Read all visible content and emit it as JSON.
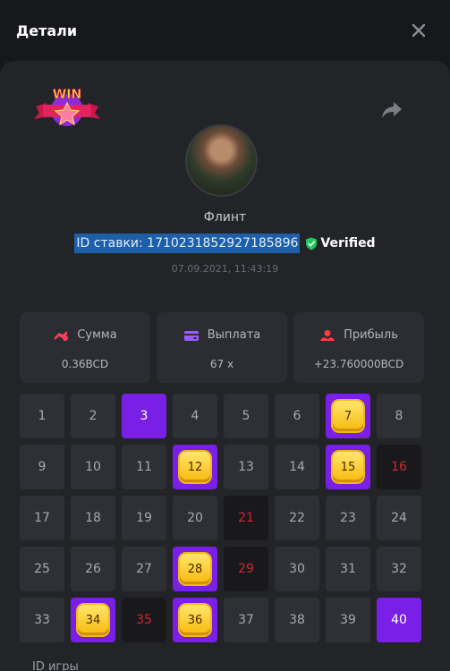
{
  "dialog": {
    "title": "Детали",
    "close_icon": "close-icon"
  },
  "header": {
    "badge": "WIN",
    "share_icon": "share-icon"
  },
  "player": {
    "name": "Флинт",
    "avatar_icon": "avatar"
  },
  "bet": {
    "id_text": "ID ставки: 1710231852927185896",
    "verified_label": "Verified",
    "date": "07.09.2021, 11:43:19"
  },
  "stats": [
    {
      "label": "Сумма",
      "value": "0.36BCD",
      "icon": "coins-icon",
      "color": "#ff3d5a"
    },
    {
      "label": "Выплата",
      "value": "67 x",
      "icon": "wallet-icon",
      "color": "#9b5cff"
    },
    {
      "label": "Прибыль",
      "value": "+23.760000BCD",
      "icon": "profit-icon",
      "color": "#ff3d3d"
    }
  ],
  "grid": {
    "cells": [
      {
        "n": "1",
        "s": "normal"
      },
      {
        "n": "2",
        "s": "normal"
      },
      {
        "n": "3",
        "s": "picked"
      },
      {
        "n": "4",
        "s": "normal"
      },
      {
        "n": "5",
        "s": "normal"
      },
      {
        "n": "6",
        "s": "normal"
      },
      {
        "n": "7",
        "s": "hit"
      },
      {
        "n": "8",
        "s": "normal"
      },
      {
        "n": "9",
        "s": "normal"
      },
      {
        "n": "10",
        "s": "normal"
      },
      {
        "n": "11",
        "s": "normal"
      },
      {
        "n": "12",
        "s": "hit"
      },
      {
        "n": "13",
        "s": "normal"
      },
      {
        "n": "14",
        "s": "normal"
      },
      {
        "n": "15",
        "s": "hit"
      },
      {
        "n": "16",
        "s": "miss"
      },
      {
        "n": "17",
        "s": "normal"
      },
      {
        "n": "18",
        "s": "normal"
      },
      {
        "n": "19",
        "s": "normal"
      },
      {
        "n": "20",
        "s": "normal"
      },
      {
        "n": "21",
        "s": "miss"
      },
      {
        "n": "22",
        "s": "normal"
      },
      {
        "n": "23",
        "s": "normal"
      },
      {
        "n": "24",
        "s": "normal"
      },
      {
        "n": "25",
        "s": "normal"
      },
      {
        "n": "26",
        "s": "normal"
      },
      {
        "n": "27",
        "s": "normal"
      },
      {
        "n": "28",
        "s": "hit"
      },
      {
        "n": "29",
        "s": "miss"
      },
      {
        "n": "30",
        "s": "normal"
      },
      {
        "n": "31",
        "s": "normal"
      },
      {
        "n": "32",
        "s": "normal"
      },
      {
        "n": "33",
        "s": "normal"
      },
      {
        "n": "34",
        "s": "hit"
      },
      {
        "n": "35",
        "s": "miss"
      },
      {
        "n": "36",
        "s": "hit"
      },
      {
        "n": "37",
        "s": "normal"
      },
      {
        "n": "38",
        "s": "normal"
      },
      {
        "n": "39",
        "s": "normal"
      },
      {
        "n": "40",
        "s": "picked"
      }
    ]
  },
  "footer": {
    "game_id_label": "ID игры"
  },
  "colors": {
    "accent": "#7a1fe6",
    "gem": "#f6c21a",
    "miss_text": "#d3262f",
    "verified": "#22c55e"
  }
}
